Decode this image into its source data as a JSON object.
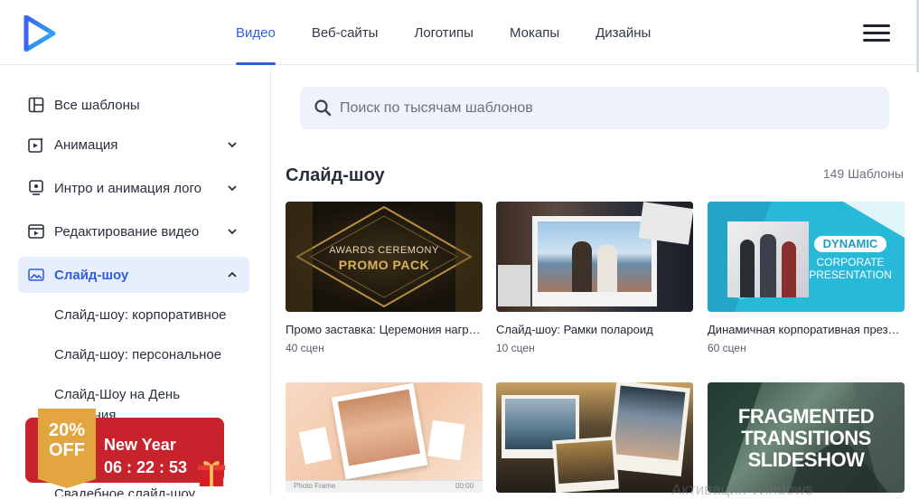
{
  "header": {
    "nav": [
      "Видео",
      "Веб-сайты",
      "Логотипы",
      "Мокапы",
      "Дизайны"
    ],
    "active_nav": 0
  },
  "sidebar": {
    "items": [
      {
        "label": "Все шаблоны",
        "icon": "grid-icon"
      },
      {
        "label": "Анимация",
        "icon": "animation-icon"
      },
      {
        "label": "Интро и анимация лого",
        "icon": "logo-intro-icon"
      },
      {
        "label": "Редактирование видео",
        "icon": "video-edit-icon"
      },
      {
        "label": "Слайд-шоу",
        "icon": "slideshow-icon"
      }
    ],
    "sub_items": [
      "Слайд-шоу: корпоративное",
      "Слайд-шоу: персональное",
      "Слайд-Шоу на День",
      "рождения",
      "Свадебное слайд-шоу"
    ]
  },
  "promo": {
    "percent": "20%",
    "off": "OFF",
    "title": "New Year",
    "timer": "06 : 22 : 53"
  },
  "search": {
    "placeholder": "Поиск по тысячам шаблонов"
  },
  "section": {
    "title": "Слайд-шоу",
    "count": "149 Шаблоны"
  },
  "cards": [
    {
      "title": "Промо заставка: Церемония награждения",
      "scenes": "40 сцен",
      "thumb_text_1": "AWARDS CEREMONY",
      "thumb_text_2": "PROMO PACK"
    },
    {
      "title": "Слайд-шоу: Рамки полароид",
      "scenes": "10 сцен"
    },
    {
      "title": "Динамичная корпоративная презентация",
      "scenes": "60 сцен",
      "thumb_text_1": "DYNAMIC",
      "thumb_text_2": "CORPORATE",
      "thumb_text_3": "PRESENTATION"
    },
    {
      "thumb_text_1": "Photo Frame",
      "thumb_text_2": "00:00"
    },
    {},
    {
      "thumb_text_1": "FRAGMENTED",
      "thumb_text_2": "TRANSITIONS",
      "thumb_text_3": "SLIDESHOW"
    }
  ],
  "watermark": "Активация Windows",
  "colors": {
    "accent": "#2f5fe0",
    "promo": "#c8232c",
    "promo_tag": "#e2a540"
  }
}
